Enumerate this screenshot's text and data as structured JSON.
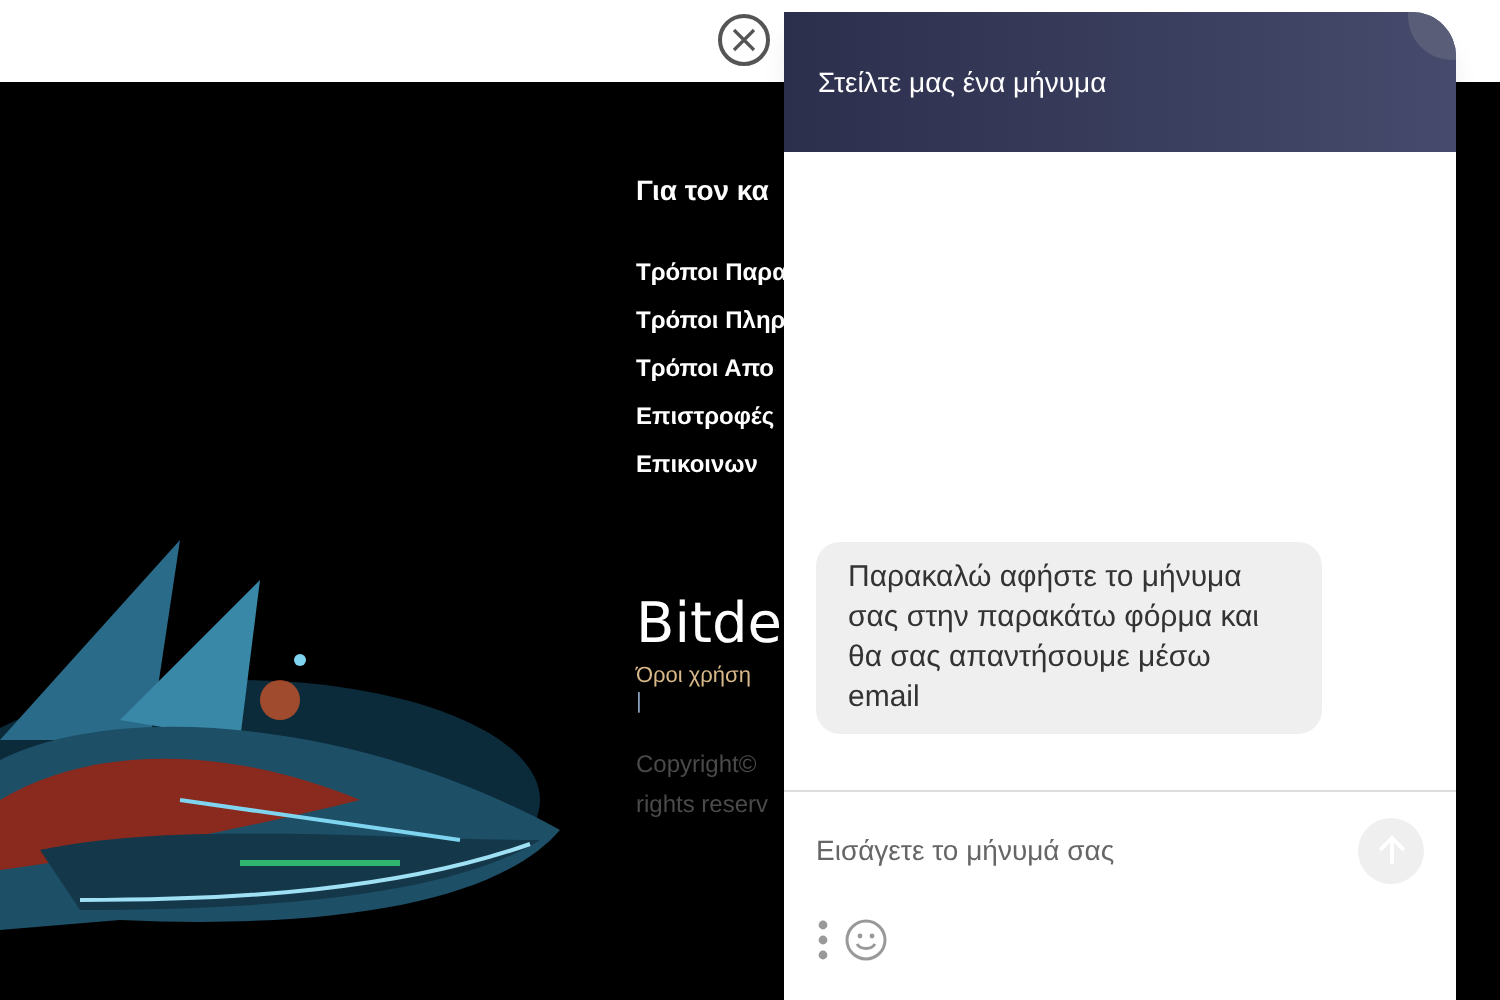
{
  "footer": {
    "heading": "Για τον κα",
    "links": [
      "Τρόποι Παρα",
      "Τρόποι Πληρ",
      "Τρόποι Απο",
      "Επιστροφές",
      "Επικοινων"
    ],
    "logo": "Bitde",
    "terms": "Όροι χρήση",
    "separator": "|",
    "copyright": [
      "Copyright©",
      "rights reserv"
    ]
  },
  "chat": {
    "title": "Στείλτε μας ένα μήνυμα",
    "messages": [
      "Παρακαλώ αφήστε το μήνυμα σας στην παρακάτω φόρμα και θα σας απαντήσουμε μέσω email"
    ],
    "input": {
      "placeholder": "Εισάγετε το μήνυμά σας"
    }
  }
}
